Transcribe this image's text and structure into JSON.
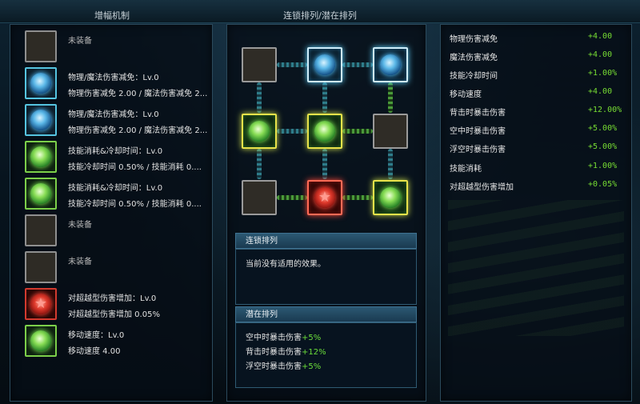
{
  "headers": {
    "left": "增幅机制",
    "middle": "连锁排列/潜在排列"
  },
  "left_slots": [
    {
      "type": "empty",
      "line1": "未装备",
      "line2": ""
    },
    {
      "type": "blue",
      "icon": "blue-orb-icon",
      "line1": "物理/魔法伤害减免：Lv.0",
      "line2": "物理伤害减免 2.00 / 魔法伤害减免 2..."
    },
    {
      "type": "blue",
      "icon": "blue-orb-icon",
      "line1": "物理/魔法伤害减免：Lv.0",
      "line2": "物理伤害减免 2.00 / 魔法伤害减免 2..."
    },
    {
      "type": "green",
      "icon": "green-orb-icon",
      "line1": "技能消耗&冷却时间：Lv.0",
      "line2": "技能冷却时间 0.50% / 技能消耗 0...."
    },
    {
      "type": "green",
      "icon": "green-orb-icon",
      "line1": "技能消耗&冷却时间：Lv.0",
      "line2": "技能冷却时间 0.50% / 技能消耗 0...."
    },
    {
      "type": "empty",
      "line1": "未装备",
      "line2": ""
    },
    {
      "type": "empty",
      "line1": "未装备",
      "line2": ""
    },
    {
      "type": "red",
      "icon": "red-star-orb-icon",
      "line1": "对超越型伤害增加：Lv.0",
      "line2": "对超越型伤害增加 0.05%"
    },
    {
      "type": "green",
      "icon": "green-orb-icon",
      "line1": "移动速度：Lv.0",
      "line2": "移动速度 4.00"
    }
  ],
  "grid": [
    [
      "empty",
      "blue",
      "blue"
    ],
    [
      "green",
      "green",
      "empty"
    ],
    [
      "empty",
      "red",
      "green"
    ]
  ],
  "chain": {
    "title": "连锁排列",
    "text": "当前没有适用的效果。"
  },
  "potential": {
    "title": "潜在排列",
    "items": [
      {
        "name": "空中时暴击伤害",
        "value": "+5%"
      },
      {
        "name": "背击时暴击伤害",
        "value": "+12%"
      },
      {
        "name": "浮空时暴击伤害",
        "value": "+5%"
      }
    ]
  },
  "stats": [
    {
      "name": "物理伤害减免",
      "value": "+4.00"
    },
    {
      "name": "魔法伤害减免",
      "value": "+4.00"
    },
    {
      "name": "技能冷却时间",
      "value": "+1.00%"
    },
    {
      "name": "移动速度",
      "value": "+4.00"
    },
    {
      "name": "背击时暴击伤害",
      "value": "+12.00%"
    },
    {
      "name": "空中时暴击伤害",
      "value": "+5.00%"
    },
    {
      "name": "浮空时暴击伤害",
      "value": "+5.00%"
    },
    {
      "name": "技能消耗",
      "value": "+1.00%"
    },
    {
      "name": "对超越型伤害增加",
      "value": "+0.05%"
    }
  ],
  "colors": {
    "stat_value": "#77dd33",
    "potential_value": "#6bde3a"
  }
}
